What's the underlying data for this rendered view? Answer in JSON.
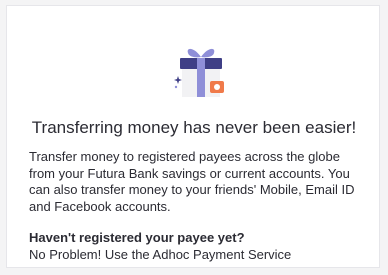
{
  "intro": {
    "illustration_icon": "gift-box-icon",
    "title": "Transferring money has never been easier!",
    "description_lines": [
      "Transfer money to registered payees across the globe",
      "from your Futura Bank savings or current accounts. You",
      "can also transfer money to your friends' Mobile, Email ID",
      "and Facebook accounts."
    ],
    "question": "Haven't registered your payee yet?",
    "answer": "No Problem! Use the Adhoc Payment Service"
  },
  "colors": {
    "ribbon": "#8f8fd8",
    "box_lid": "#3f3f86",
    "box_body": "#f2f2f4",
    "accent_orange": "#f07a4a",
    "text": "#2b2b33"
  }
}
